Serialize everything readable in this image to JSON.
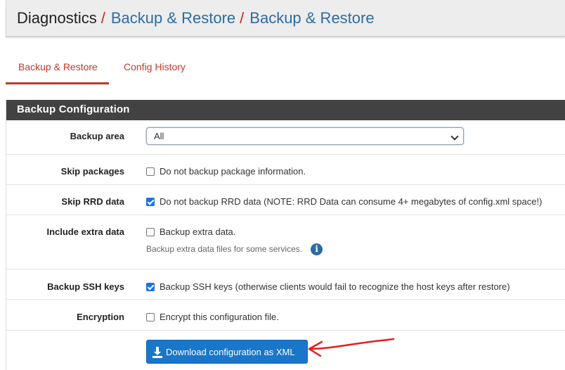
{
  "breadcrumb": {
    "root": "Diagnostics",
    "separator": "/",
    "items": [
      "Backup & Restore",
      "Backup & Restore"
    ]
  },
  "tabs": [
    {
      "label": "Backup & Restore",
      "active": true
    },
    {
      "label": "Config History",
      "active": false
    }
  ],
  "panel": {
    "title": "Backup Configuration",
    "backup_area": {
      "label": "Backup area",
      "selected": "All"
    },
    "skip_packages": {
      "label": "Skip packages",
      "checked": false,
      "text": "Do not backup package information."
    },
    "skip_rrd": {
      "label": "Skip RRD data",
      "checked": true,
      "text": "Do not backup RRD data (NOTE: RRD Data can consume 4+ megabytes of config.xml space!)"
    },
    "extra_data": {
      "label": "Include extra data",
      "checked": false,
      "text": "Backup extra data.",
      "help": "Backup extra data files for some services."
    },
    "ssh_keys": {
      "label": "Backup SSH keys",
      "checked": true,
      "text": "Backup SSH keys (otherwise clients would fail to recognize the host keys after restore)"
    },
    "encryption": {
      "label": "Encryption",
      "checked": false,
      "text": "Encrypt this configuration file."
    },
    "download_button": "Download configuration as XML"
  },
  "colors": {
    "accent_red": "#c0392b",
    "link_blue": "#2d6ca2",
    "button_blue": "#1976c8",
    "heading_dark": "#424242",
    "annotation_red": "#e02020"
  },
  "icons": {
    "info": "info-icon",
    "download": "download-icon",
    "annotation": "red-arrow-annotation"
  }
}
